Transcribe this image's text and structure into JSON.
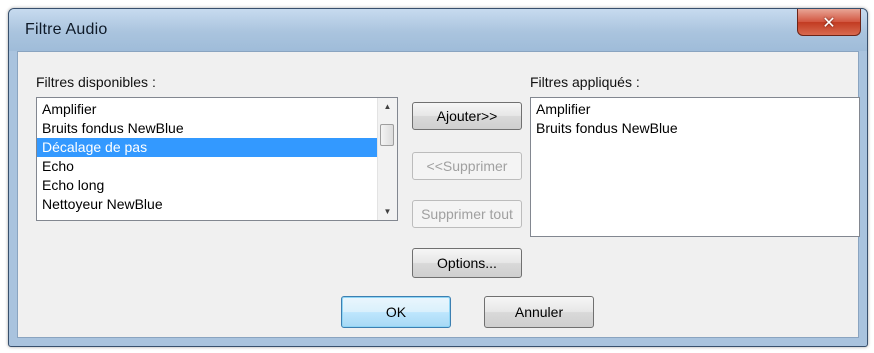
{
  "window": {
    "title": "Filtre Audio",
    "close_glyph": "✕"
  },
  "available": {
    "label": "Filtres disponibles :",
    "items": [
      "Amplifier",
      "Bruits fondus NewBlue",
      "Décalage de pas",
      "Echo",
      "Echo long",
      "Nettoyeur NewBlue"
    ],
    "selected": "Décalage de pas"
  },
  "applied": {
    "label": "Filtres appliqués :",
    "items": [
      "Amplifier",
      "Bruits fondus NewBlue"
    ]
  },
  "buttons": {
    "add": "Ajouter>>",
    "remove": "<<Supprimer",
    "remove_all": "Supprimer tout",
    "options": "Options...",
    "ok": "OK",
    "cancel": "Annuler"
  },
  "scroll": {
    "up_glyph": "▲",
    "down_glyph": "▼"
  },
  "colors": {
    "selection": "#3399ff",
    "title_bar": "#aac4de",
    "close_button": "#c94a34"
  }
}
